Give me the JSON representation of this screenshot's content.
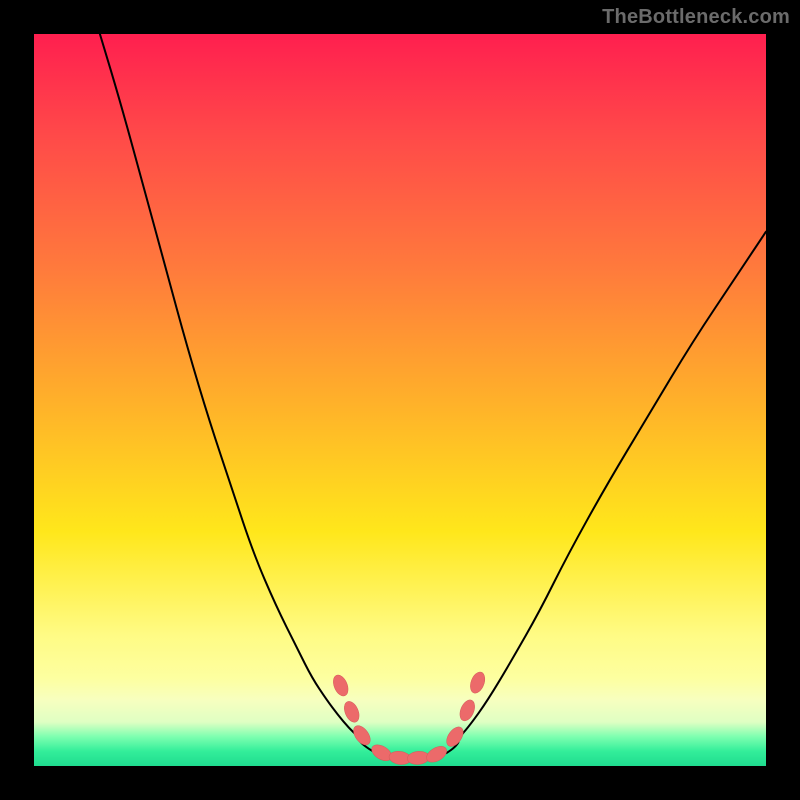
{
  "watermark_text": "TheBottleneck.com",
  "colors": {
    "frame_bg": "#000000",
    "watermark": "#6b6b6b",
    "curve_stroke": "#000000",
    "marker_fill": "#ec6a6a",
    "gradient_top": "#ff1f4f",
    "gradient_bottom": "#1fdc8f"
  },
  "chart_data": {
    "type": "line",
    "title": "",
    "xlabel": "",
    "ylabel": "",
    "xrange": [
      0,
      100
    ],
    "yrange_percent_from_top": [
      0,
      100
    ],
    "note": "x is horizontal position (left-to-right) in percent of plot width; y is vertical position from top of gradient in percent (0 = top/red, 100 = bottom/green). Curve is a V-shaped bottleneck trace with a flat minimum near y≈97–99 around x≈44–58.",
    "series": [
      {
        "name": "left-branch",
        "x": [
          9,
          12,
          15,
          18,
          21,
          24,
          27,
          30,
          33,
          36,
          38,
          40,
          41.5,
          43,
          44.5
        ],
        "y": [
          0,
          10,
          21,
          32,
          43,
          53,
          62,
          71,
          78,
          84,
          88,
          91,
          93,
          94.8,
          96.2
        ]
      },
      {
        "name": "flat-minimum",
        "x": [
          44.5,
          47,
          50,
          53,
          56,
          58
        ],
        "y": [
          96.8,
          98.5,
          99.0,
          99.0,
          98.6,
          97.0
        ]
      },
      {
        "name": "right-branch",
        "x": [
          58,
          59.5,
          62,
          65,
          69,
          73,
          78,
          84,
          90,
          96,
          100
        ],
        "y": [
          96.2,
          94.5,
          91,
          86,
          79,
          71,
          62,
          52,
          42,
          33,
          27
        ]
      }
    ],
    "markers": {
      "name": "highlight-segments",
      "shape": "rounded-capsule",
      "approx_points_percent": [
        {
          "x": 41.9,
          "y": 89.0
        },
        {
          "x": 43.4,
          "y": 92.6
        },
        {
          "x": 44.8,
          "y": 95.8
        },
        {
          "x": 47.5,
          "y": 98.2
        },
        {
          "x": 50.0,
          "y": 98.9
        },
        {
          "x": 52.5,
          "y": 98.9
        },
        {
          "x": 55.0,
          "y": 98.4
        },
        {
          "x": 57.5,
          "y": 96.0
        },
        {
          "x": 59.2,
          "y": 92.4
        },
        {
          "x": 60.6,
          "y": 88.6
        }
      ]
    }
  }
}
